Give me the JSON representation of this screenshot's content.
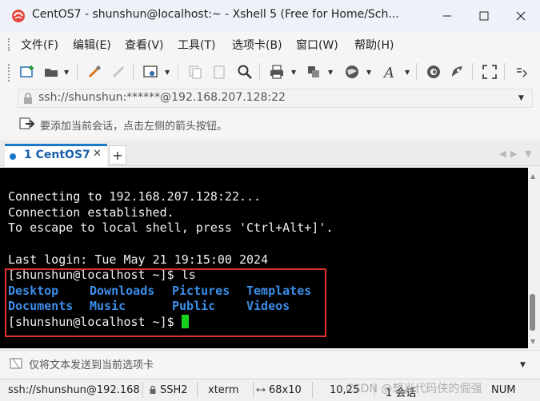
{
  "window": {
    "title": "CentOS7 - shunshun@localhost:~ - Xshell 5 (Free for Home/Sch...",
    "accent": "#1b79c8"
  },
  "menu": [
    "文件(F)",
    "编辑(E)",
    "查看(V)",
    "工具(T)",
    "选项卡(B)",
    "窗口(W)",
    "帮助(H)"
  ],
  "address": {
    "value": "ssh://shunshun:******@192.168.207.128:22"
  },
  "hint": "要添加当前会话，点击左侧的箭头按钮。",
  "tabs": [
    {
      "label": "1 CentOS7",
      "active": true
    }
  ],
  "terminal": {
    "lines": [
      "Connecting to 192.168.207.128:22...",
      "Connection established.",
      "To escape to local shell, press 'Ctrl+Alt+]'.",
      "",
      "Last login: Tue May 21 19:15:00 2024",
      "[shunshun@localhost ~]$ ls"
    ],
    "ls_row1": [
      "Desktop",
      "Downloads",
      "Pictures",
      "Templates"
    ],
    "ls_row2": [
      "Documents",
      "Music",
      "Public",
      "Videos"
    ],
    "prompt": "[shunshun@localhost ~]$ ",
    "dir_color": "#3b8eea",
    "cursor_color": "#17d11c",
    "highlight_color": "#e03030"
  },
  "sendbar": {
    "text": "仅将文本发送到当前选项卡"
  },
  "status": {
    "session": "ssh://shunshun@192.168",
    "protocol": "SSH2",
    "terminal": "xterm",
    "size": "68x10",
    "position": "10,25",
    "sessions": "1 会话",
    "num": "NUM"
  },
  "watermark": "CSDN @想当代码侠的倔强"
}
